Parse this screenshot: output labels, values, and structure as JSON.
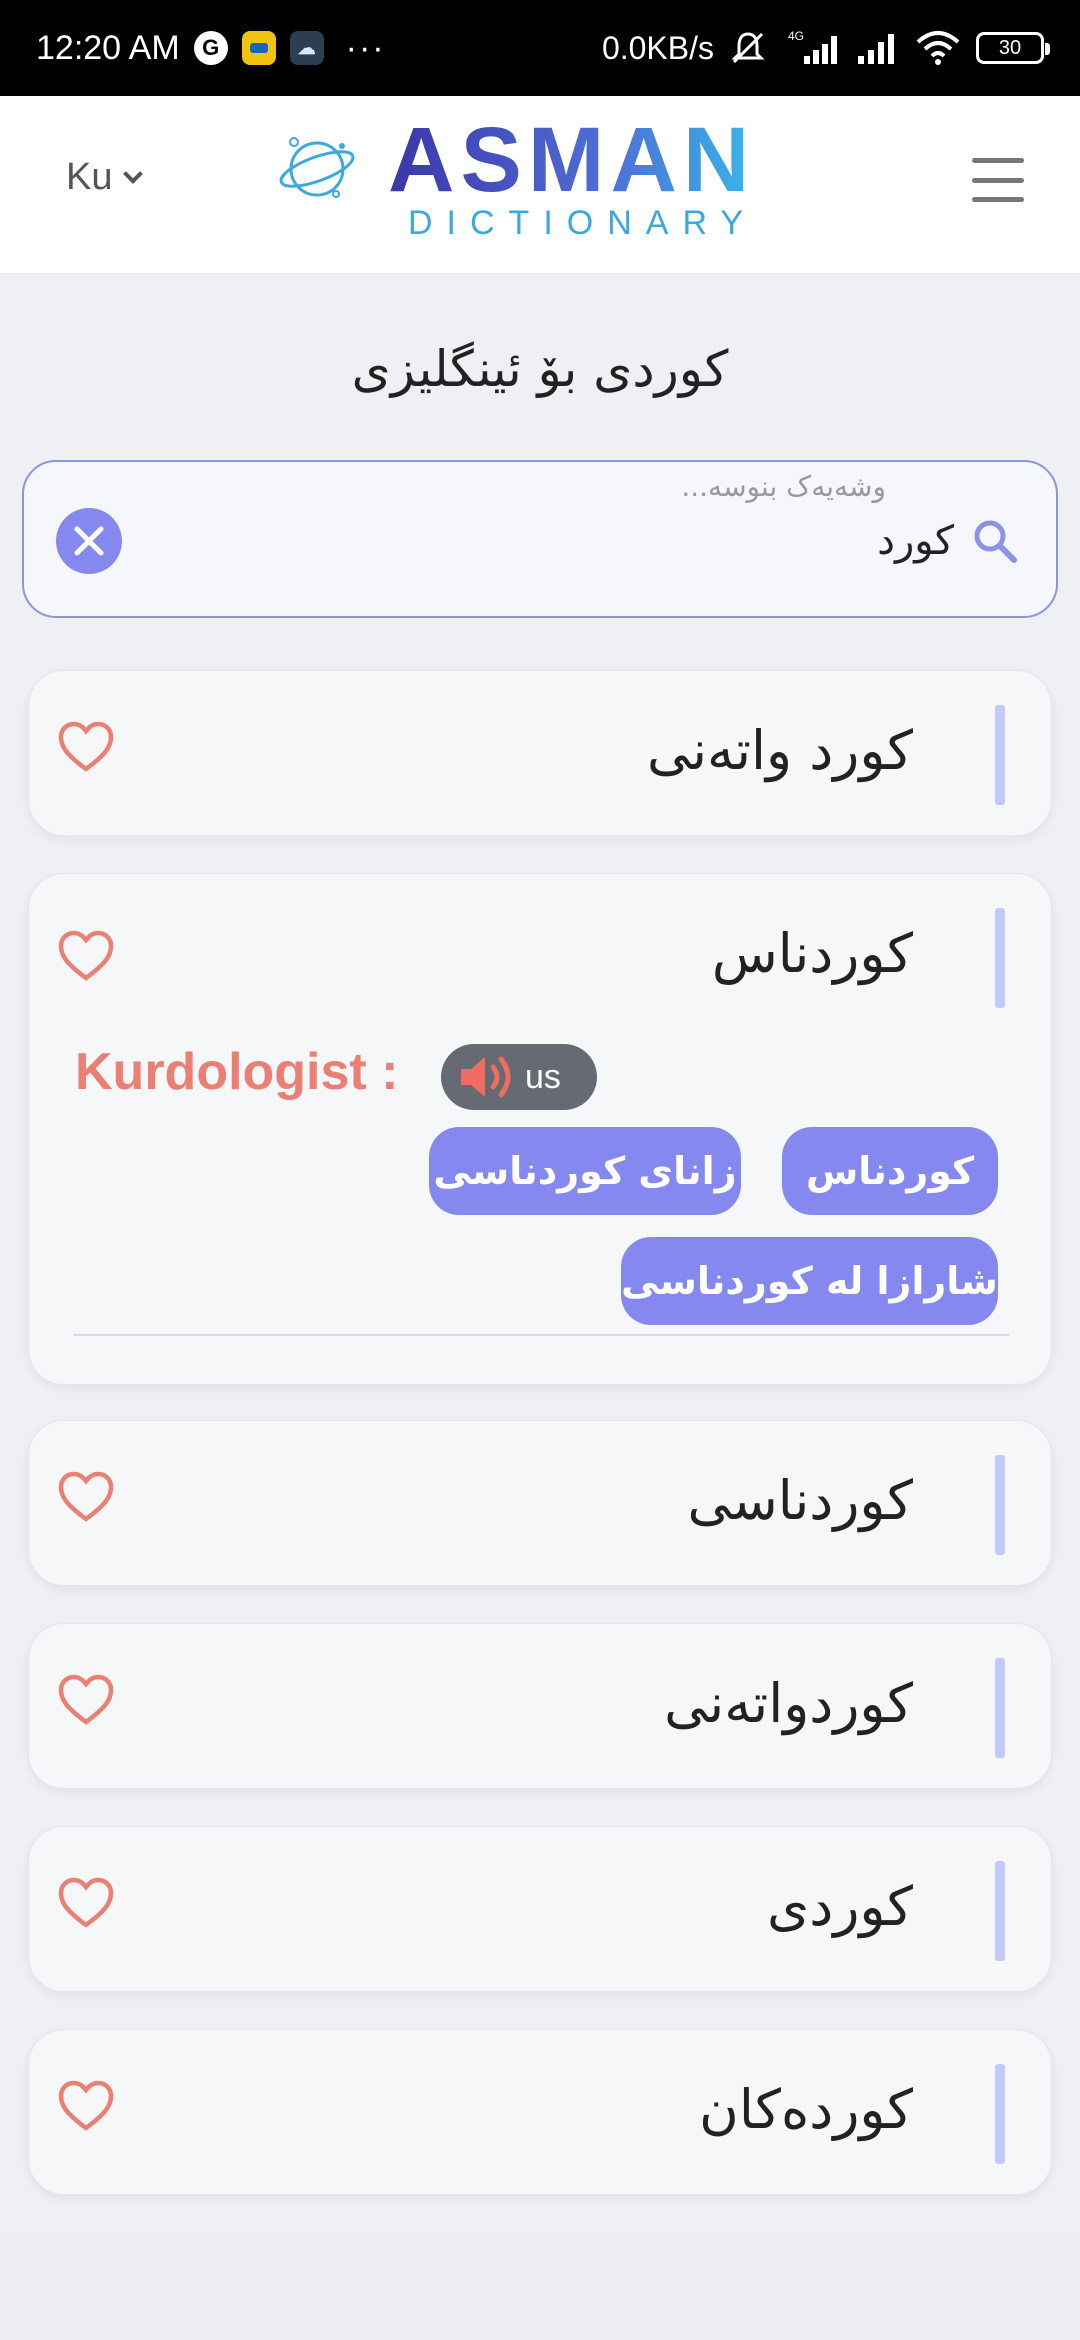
{
  "status_bar": {
    "time": "12:20 AM",
    "app_icons": [
      "google-icon",
      "notification-app-icon",
      "weather-app-icon"
    ],
    "more": "···",
    "network_speed": "0.0KB/s",
    "network_type": "4G",
    "battery": "30"
  },
  "header": {
    "language": "Ku",
    "logo_main": "ASMAN",
    "logo_sub": "DICTIONARY"
  },
  "page_title": "کوردی بۆ ئینگلیزی",
  "search": {
    "placeholder": "وشەیەک بنوسە...",
    "value": "کورد"
  },
  "results": [
    {
      "word": "کورد واتەنی"
    },
    {
      "word": "کوردناس",
      "translation": "Kurdologist :",
      "audio_label": "us",
      "synonyms": [
        "کوردناس",
        "زانای کوردناسی",
        "شارازا لە کوردناسی"
      ]
    },
    {
      "word": "کوردناسی"
    },
    {
      "word": "کوردواتەنی"
    },
    {
      "word": "کوردی"
    },
    {
      "word": "کوردەکان"
    }
  ],
  "colors": {
    "accent": "#8589ef",
    "translation": "#ea7f73",
    "heart": "#ea7f73",
    "card_bar": "#c3c8fb"
  }
}
